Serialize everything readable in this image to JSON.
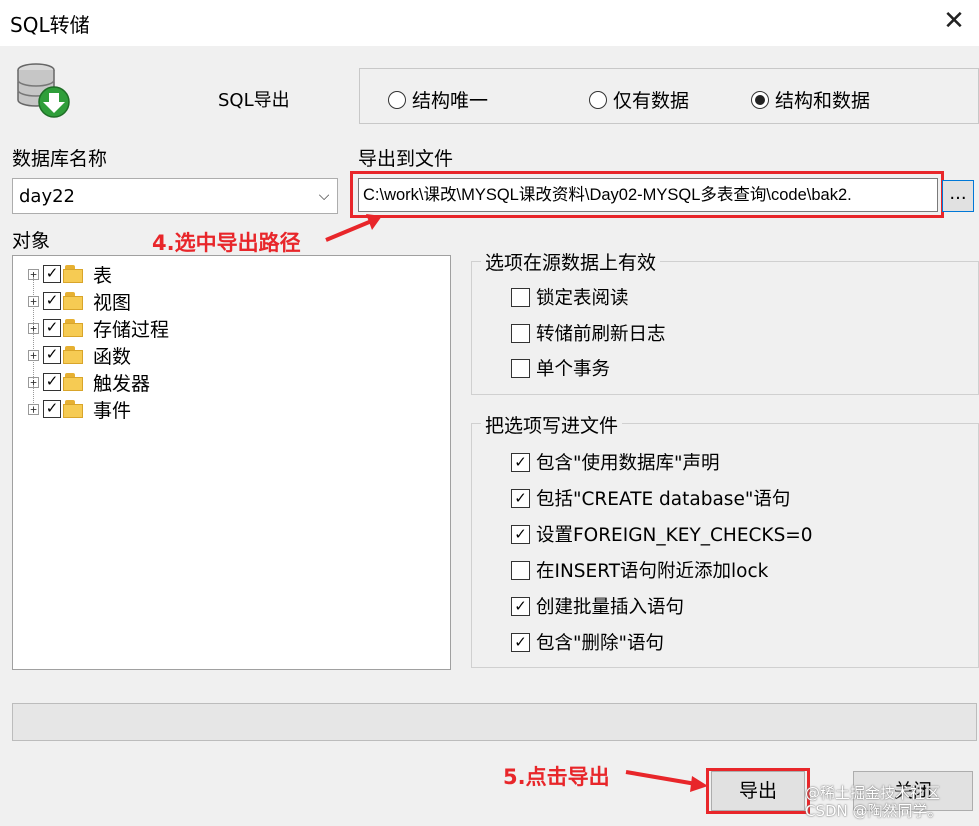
{
  "window": {
    "title": "SQL转储",
    "close_label": "✕"
  },
  "header": {
    "icon": "database-download-icon",
    "sql_export_label": "SQL导出"
  },
  "export_mode": {
    "options": [
      {
        "label": "结构唯一",
        "selected": false
      },
      {
        "label": "仅有数据",
        "selected": false
      },
      {
        "label": "结构和数据",
        "selected": true
      }
    ]
  },
  "database": {
    "label": "数据库名称",
    "selected": "day22"
  },
  "output_file": {
    "label": "导出到文件",
    "path": "C:\\work\\课改\\MYSQL课改资料\\Day02-MYSQL多表查询\\code\\bak2.",
    "browse_label": "..."
  },
  "objects": {
    "label": "对象",
    "items": [
      {
        "label": "表",
        "checked": true
      },
      {
        "label": "视图",
        "checked": true
      },
      {
        "label": "存储过程",
        "checked": true
      },
      {
        "label": "函数",
        "checked": true
      },
      {
        "label": "触发器",
        "checked": true
      },
      {
        "label": "事件",
        "checked": true
      }
    ]
  },
  "source_options": {
    "title": "选项在源数据上有效",
    "items": [
      {
        "label": "锁定表阅读",
        "checked": false
      },
      {
        "label": "转储前刷新日志",
        "checked": false
      },
      {
        "label": "单个事务",
        "checked": false
      }
    ]
  },
  "file_options": {
    "title": "把选项写进文件",
    "items": [
      {
        "label": "包含\"使用数据库\"声明",
        "checked": true
      },
      {
        "label": "包括\"CREATE database\"语句",
        "checked": true
      },
      {
        "label": "设置FOREIGN_KEY_CHECKS=0",
        "checked": true
      },
      {
        "label": "在INSERT语句附近添加lock",
        "checked": false
      },
      {
        "label": "创建批量插入语句",
        "checked": true
      },
      {
        "label": "包含\"删除\"语句",
        "checked": true
      }
    ]
  },
  "annotations": {
    "step4": "4.选中导出路径",
    "step5": "5.点击导出"
  },
  "buttons": {
    "export": "导出",
    "close": "关闭"
  },
  "watermark": {
    "line1": "@稀土掘金技术社区",
    "line2": "CSDN @陶然同学。"
  },
  "colors": {
    "annotation_red": "#e8262a",
    "window_bg": "#f0f0f0"
  }
}
